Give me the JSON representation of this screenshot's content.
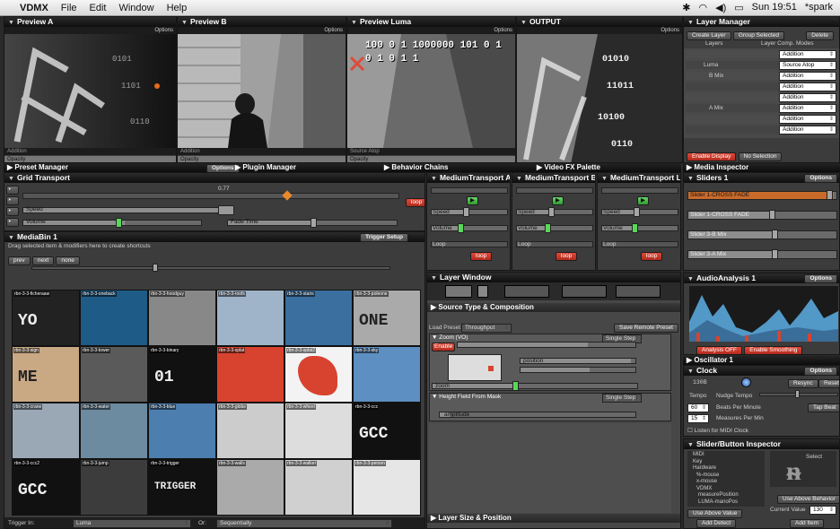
{
  "menubar": {
    "app": "VDMX",
    "items": [
      "File",
      "Edit",
      "Window",
      "Help"
    ],
    "clock": "Sun 19:51",
    "user": "*spark"
  },
  "previews": [
    {
      "title": "Preview A",
      "options": "Options",
      "blend": "Addition",
      "opacity": "Opacity"
    },
    {
      "title": "Preview B",
      "options": "Options",
      "blend": "Addition",
      "opacity": "Opacity"
    },
    {
      "title": "Preview Luma",
      "options": "Options",
      "blend": "Source Atop",
      "opacity": "Opacity",
      "overlay": "100 0 1 1000000 101 0 1 0 1 0 1 1"
    },
    {
      "title": "OUTPUT",
      "options": "Options"
    }
  ],
  "layer_manager": {
    "title": "Layer Manager",
    "buttons": [
      "Create Layer",
      "Group Selected",
      "Delete"
    ],
    "cols": [
      "Layers",
      "Layer Comp. Modes"
    ],
    "rows": [
      {
        "name": "",
        "mode": "Addition"
      },
      {
        "name": "Luma",
        "mode": "Source Atop"
      },
      {
        "name": "B Mix",
        "mode": "Addition"
      },
      {
        "name": "",
        "mode": "Addition"
      },
      {
        "name": "",
        "mode": "Addition"
      },
      {
        "name": "A Mix",
        "mode": "Addition"
      },
      {
        "name": "",
        "mode": "Addition"
      },
      {
        "name": "",
        "mode": "Addition"
      }
    ],
    "bottom_buttons": [
      "Enable Display",
      "No Selection"
    ]
  },
  "bars": {
    "preset": "Preset Manager",
    "options": "Options",
    "plugin": "Plugin Manager",
    "behavior": "Behavior Chains",
    "vfx": "Video FX Palette",
    "media_inspector": "Media Inspector"
  },
  "grid_transport": {
    "title": "Grid Transport",
    "speed": "Speed",
    "volume": "Volume",
    "fade": "Fade Time",
    "loop": "loop",
    "value": "0.77"
  },
  "medium_transports": [
    {
      "title": "MediumTransport A",
      "loop": "loop"
    },
    {
      "title": "MediumTransport B",
      "loop": "loop"
    },
    {
      "title": "MediumTransport Lu",
      "loop": "loop"
    }
  ],
  "transport_labels": [
    "Speed",
    "Volume",
    "Loop"
  ],
  "sliders": {
    "title": "Sliders 1",
    "options": "Options",
    "items": [
      "Slider 1-CROSS FADE",
      "Slider 1-CROSS FADE",
      "Slider 3-B Mix",
      "Slider 3-A Mix"
    ]
  },
  "mediabin": {
    "title": "MediaBin 1",
    "hint": "Drag selected item & modifiers here to create shortcuts",
    "trigger": "Trigger Setup",
    "tabs": [
      "prev",
      "next",
      "none"
    ],
    "trig_label": "Trigger In:",
    "trig_value": "Luma",
    "order_label": "Or:",
    "order_value": "Sequentially",
    "thumbs": [
      {
        "name": "rbn-3-3-ficheraaw",
        "text": "YO"
      },
      {
        "name": "rbn-3-3-oneback",
        "text": ""
      },
      {
        "name": "rbn-3-3-hoodguy",
        "text": ""
      },
      {
        "name": "rbn-3-3-roofs",
        "text": ""
      },
      {
        "name": "rbn-3-3-stairs",
        "text": ""
      },
      {
        "name": "rbn-3-3-poleone",
        "text": "ONE"
      },
      {
        "name": "rbn-3-3-sign",
        "text": "ME"
      },
      {
        "name": "rbn-3-3-tower",
        "text": ""
      },
      {
        "name": "rbn-3-3-binary",
        "text": "01"
      },
      {
        "name": "rbn-3-3-splat",
        "text": ""
      },
      {
        "name": "rbn-3-3-splat2",
        "text": ""
      },
      {
        "name": "rbn-3-3-sky",
        "text": ""
      },
      {
        "name": "rbn-3-3-crane",
        "text": ""
      },
      {
        "name": "rbn-3-3-water",
        "text": ""
      },
      {
        "name": "rbn-3-3-blue",
        "text": ""
      },
      {
        "name": "rbn-3-3-globe",
        "text": ""
      },
      {
        "name": "rbn-3-3-wheel",
        "text": ""
      },
      {
        "name": "rbn-3-3-ccc",
        "text": "GCC"
      },
      {
        "name": "rbn-3-3-ccc2",
        "text": "GCC"
      },
      {
        "name": "rbn-3-3-jump",
        "text": ""
      },
      {
        "name": "rbn-3-3-trigger",
        "text": "TRIGGER"
      },
      {
        "name": "rbn-3-3-walls",
        "text": ""
      },
      {
        "name": "rbn-3-3-walker",
        "text": ""
      },
      {
        "name": "rbn-3-3-person",
        "text": ""
      }
    ]
  },
  "layer_window": {
    "title": "Layer Window",
    "source": "Source Type & Composition",
    "load": "Load Preset",
    "preset": "Throughput",
    "save": "Save Remote Preset",
    "zoom": "Zoom (VO)",
    "zoom_val": "Enable",
    "position": "position",
    "zoom_lbl": "zoom",
    "heightfield": "Height Field From Mask",
    "amplitude": "amplitude",
    "size_pos": "Layer Size & Position",
    "enable": "Enable",
    "mode": "Single Step"
  },
  "audio": {
    "title": "AudioAnalysis 1",
    "options": "Options",
    "btns": [
      "Analysis OFF",
      "Enable Smoothing"
    ]
  },
  "oscillator": {
    "title": "Oscillator 1"
  },
  "clock": {
    "title": "Clock",
    "options": "Options",
    "value": "130B",
    "tempo": "Tempo",
    "nudge": "Nudge Tempo",
    "bpm": "Beats Per Minute",
    "mpm": "Measures Per Min",
    "bpm_val": "60",
    "mpm_val": "15",
    "tap": "Tap Beat",
    "resync": "Resync",
    "reset": "Reset",
    "midi": "Listen for MIDI Clock"
  },
  "inspector": {
    "title": "Slider/Button Inspector",
    "tree": [
      "MIDI",
      "Key",
      "Hardware",
      "%-mouse",
      "x-mouse",
      "VDMX",
      "measurePosition",
      "LUMA-manoPos"
    ],
    "select": "Select",
    "use_above": "Use Above Behavior",
    "use_above2": "Use Above Value",
    "current": "Current Value",
    "current_val": "130",
    "add_detect": "Add Detect",
    "add_new": "Add Item"
  },
  "colors": {
    "accent_red": "#d8432f",
    "accent_green": "#52c952",
    "accent_orange": "#e88a2a",
    "audio_blue": "#5db0e8"
  }
}
